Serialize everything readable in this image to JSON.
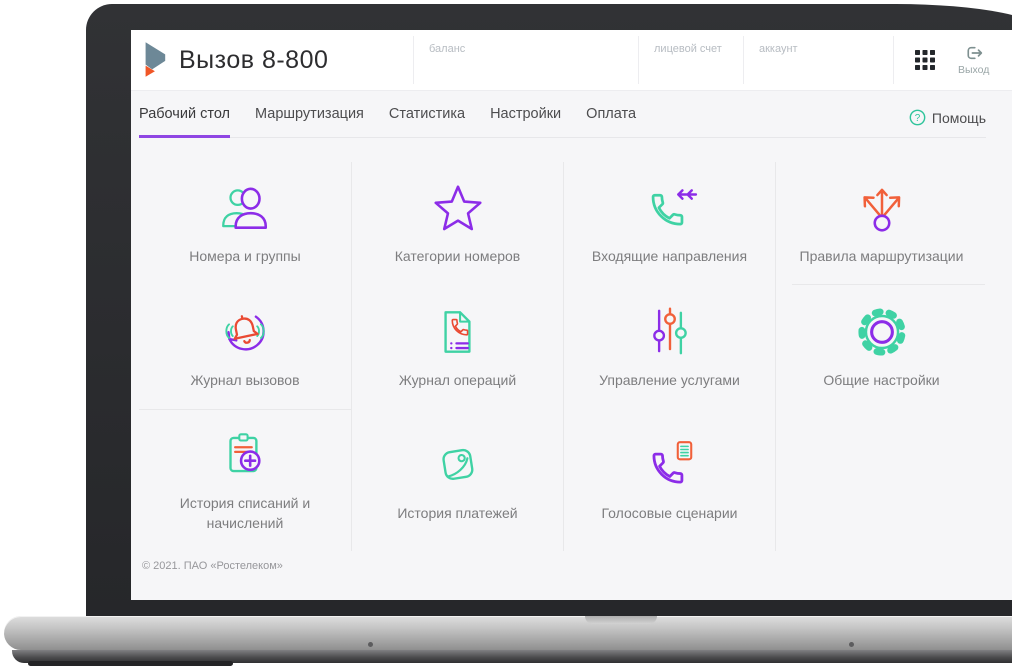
{
  "header": {
    "app_title": "Вызов 8-800",
    "account_fields": [
      {
        "id": "balance",
        "label": "баланс"
      },
      {
        "id": "personal-account",
        "label": "лицевой счет"
      },
      {
        "id": "account",
        "label": "аккаунт"
      }
    ],
    "logout_label": "Выход"
  },
  "nav": {
    "tabs": [
      {
        "id": "desktop",
        "label": "Рабочий стол",
        "active": true
      },
      {
        "id": "routing",
        "label": "Маршрутизация",
        "active": false
      },
      {
        "id": "statistics",
        "label": "Статистика",
        "active": false
      },
      {
        "id": "settings",
        "label": "Настройки",
        "active": false
      },
      {
        "id": "payment",
        "label": "Оплата",
        "active": false
      }
    ],
    "help_label": "Помощь"
  },
  "dashboard": {
    "tiles": [
      {
        "id": "numbers-groups",
        "label": "Номера и группы",
        "icon": "users-icon"
      },
      {
        "id": "number-categories",
        "label": "Категории номеров",
        "icon": "star-icon"
      },
      {
        "id": "incoming-directions",
        "label": "Входящие направления",
        "icon": "incoming-call-icon"
      },
      {
        "id": "routing-rules",
        "label": "Правила маршрутизации",
        "icon": "routing-arrows-icon"
      },
      {
        "id": "calls-log",
        "label": "Журнал вызовов",
        "icon": "call-journal-icon"
      },
      {
        "id": "operations-log",
        "label": "Журнал операций",
        "icon": "operations-journal-icon"
      },
      {
        "id": "services-management",
        "label": "Управление услугами",
        "icon": "sliders-icon"
      },
      {
        "id": "general-settings",
        "label": "Общие настройки",
        "icon": "gear-icon"
      },
      {
        "id": "charges-history",
        "label": "История списаний и начислений",
        "icon": "clipboard-plus-icon"
      },
      {
        "id": "payments-history",
        "label": "История платежей",
        "icon": "wallet-icon"
      },
      {
        "id": "voice-scenarios",
        "label": "Голосовые сценарии",
        "icon": "voice-script-icon"
      }
    ]
  },
  "footer": {
    "copyright": "© 2021. ПАО «Ростелеком»"
  },
  "colors": {
    "green": "#3fd2a4",
    "purple": "#8c2ce8",
    "orange": "#f1603a",
    "red": "#ea4a33",
    "accent": "#8f46e3",
    "bg": "#f6f6f8",
    "logo_gray": "#6d8897",
    "logo_orange": "#f05626"
  }
}
